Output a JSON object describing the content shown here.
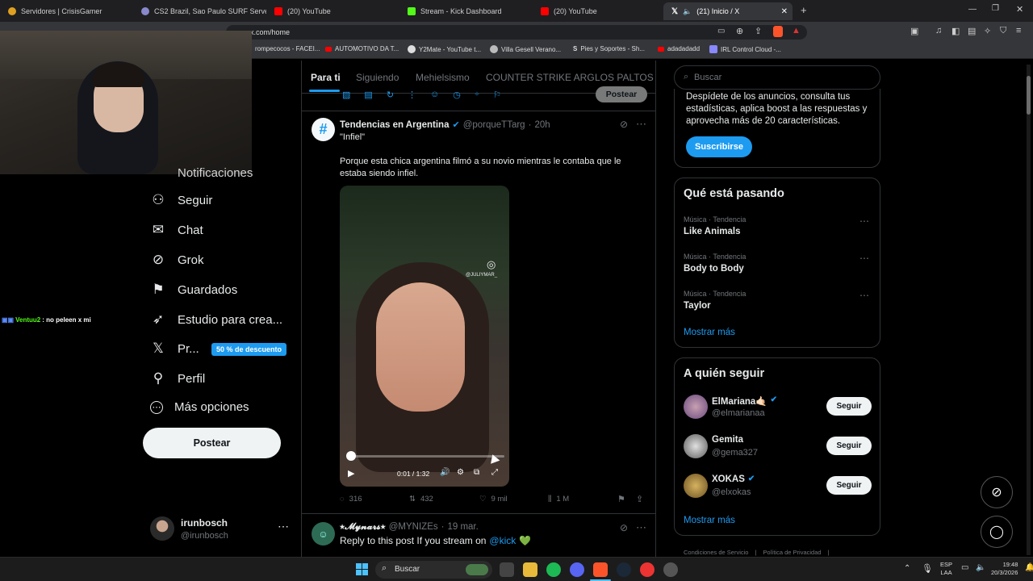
{
  "browser": {
    "tabs": [
      {
        "label": "Servidores | CrisisGamer",
        "color": "#e0a020"
      },
      {
        "label": "CS2 Brazil, Sao Paulo SURF Servers -",
        "color": "#8888cc"
      },
      {
        "label": "(20) YouTube",
        "color": "#ff0000"
      },
      {
        "label": "Stream - Kick Dashboard",
        "color": "#53fc18"
      },
      {
        "label": "(20) YouTube",
        "color": "#ff0000"
      },
      {
        "label": "(21) Inicio / X",
        "color": "#ffffff"
      }
    ],
    "url": "x.com/home",
    "bookmarks": [
      {
        "label": "rompecocos - FACEI...",
        "color": "#e55"
      },
      {
        "label": "AUTOMOTIVO DA T...",
        "color": "#ff0000"
      },
      {
        "label": "Y2Mate - YouTube t...",
        "color": "#ddd"
      },
      {
        "label": "Villa Gesell Verano...",
        "color": "#bbb"
      },
      {
        "label": "Pies y Soportes - Sh...",
        "color": "#fff"
      },
      {
        "label": "adadadadd",
        "color": "#ff0000"
      },
      {
        "label": "IRL Control Cloud -...",
        "color": "#88f"
      }
    ]
  },
  "chat_overlay": {
    "user": "Ventuu2",
    "message": ": no peleen x mi"
  },
  "sidebar": {
    "partial_item": "Notificaciones",
    "items": [
      {
        "label": "Seguir",
        "icon": "user-plus-icon",
        "glyph": "⚇"
      },
      {
        "label": "Chat",
        "icon": "mail-icon",
        "glyph": "✉"
      },
      {
        "label": "Grok",
        "icon": "grok-icon",
        "glyph": "⊘"
      },
      {
        "label": "Guardados",
        "icon": "bookmark-icon",
        "glyph": "⚑"
      },
      {
        "label": "Estudio para crea...",
        "icon": "rocket-icon",
        "glyph": "➶"
      },
      {
        "label": "Pr...",
        "icon": "x-logo-icon",
        "glyph": "𝕏"
      },
      {
        "label": "Perfil",
        "icon": "person-icon",
        "glyph": "⚲"
      },
      {
        "label": "Más opciones",
        "icon": "more-icon",
        "glyph": "⋯"
      }
    ],
    "premium_badge": "50 % de descuento",
    "post_button": "Postear",
    "account": {
      "name": "irunbosch",
      "handle": "@irunbosch"
    }
  },
  "feed": {
    "tabs": [
      "Para ti",
      "Siguiendo",
      "Mehielsismo",
      "COUNTER STRIKE ARG",
      "LOS PALTOS"
    ],
    "compose_post_button": "Postear",
    "tweet": {
      "author": "Tendencias en Argentina",
      "handle": "@porqueTTarg",
      "time": "20h",
      "quote": "\"Infiel\"",
      "text": "Porque esta chica argentina filmó a su novio mientras le contaba que le estaba siendo infiel.",
      "watermark": "@JULIYMAR_",
      "video_time": "0:01 / 1:32",
      "video_progress": 0.01,
      "replies": "316",
      "retweets": "432",
      "likes": "9 mil",
      "views": "1 M"
    },
    "tweet2": {
      "author": "⭑𝓜𝔂𝓷𝓪𝓻𝓼⭑",
      "handle": "@MYNIZEs",
      "time": "19 mar.",
      "text": "Reply to this post If you stream on",
      "mention": "@kick",
      "emoji": "💚"
    }
  },
  "right": {
    "search_placeholder": "Buscar",
    "premium_text": "Despídete de los anuncios, consulta tus estadísticas, aplica boost a las respuestas y aprovecha más de 20 características.",
    "subscribe_button": "Suscribirse",
    "trending_title": "Qué está pasando",
    "trends": [
      {
        "meta": "Música · Tendencia",
        "title": "Like Animals"
      },
      {
        "meta": "Música · Tendencia",
        "title": "Body to Body"
      },
      {
        "meta": "Música · Tendencia",
        "title": "Taylor"
      }
    ],
    "show_more": "Mostrar más",
    "follow_title": "A quién seguir",
    "follows": [
      {
        "name": "ElMariana🤙🏻",
        "handle": "@elmarianaa",
        "verified": true,
        "button": "Seguir"
      },
      {
        "name": "Gemita",
        "handle": "@gema327",
        "verified": false,
        "button": "Seguir"
      },
      {
        "name": "XOKAS",
        "handle": "@elxokas",
        "verified": true,
        "button": "Seguir"
      }
    ],
    "show_more_2": "Mostrar más",
    "footer": [
      "Condiciones de Servicio",
      "|",
      "Política de Privacidad",
      "|"
    ]
  },
  "taskbar": {
    "search": "Buscar",
    "lang": "ESP",
    "lang2": "LAA",
    "time": "19:48",
    "date": "20/3/2026"
  }
}
